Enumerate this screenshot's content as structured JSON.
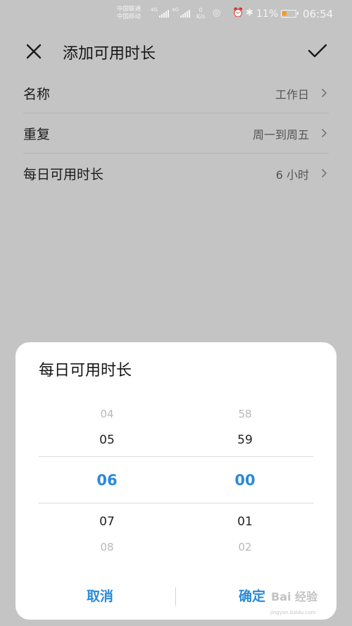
{
  "status_bar": {
    "carrier_top": "中国联通",
    "carrier_bottom": "中国移动",
    "net_type": "4G",
    "net_speed_value": "0",
    "net_speed_unit": "K/s",
    "battery": "11%",
    "battery_level": 0.11,
    "battery_color": "#f59a23",
    "time": "06:54"
  },
  "header": {
    "title": "添加可用时长",
    "close_icon": "close-icon",
    "confirm_icon": "check-icon"
  },
  "settings": [
    {
      "label": "名称",
      "value": "工作日"
    },
    {
      "label": "重复",
      "value": "周一到周五"
    },
    {
      "label": "每日可用时长",
      "value": "6 小时"
    }
  ],
  "dialog": {
    "title": "每日可用时长",
    "hours": {
      "far_prev": "04",
      "prev": "05",
      "selected": "06",
      "next": "07",
      "far_next": "08"
    },
    "minutes": {
      "far_prev": "58",
      "prev": "59",
      "selected": "00",
      "next": "01",
      "far_next": "02"
    },
    "cancel_label": "取消",
    "confirm_label": "确定",
    "accent_color": "#2a8ad8"
  },
  "watermark": {
    "brand": "Bai 经验",
    "url": "jingyan.baidu.com"
  }
}
